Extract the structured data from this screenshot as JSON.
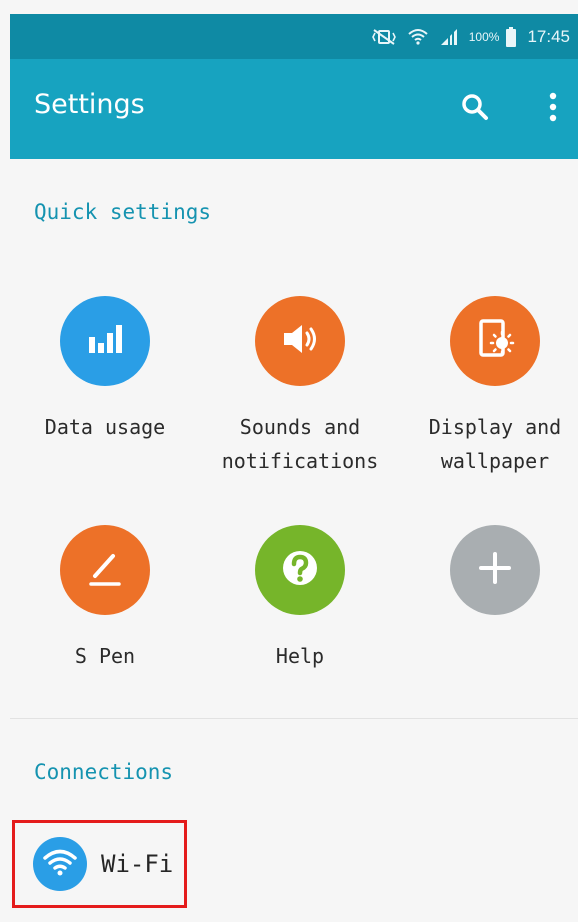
{
  "status_bar": {
    "battery_percent": "100%",
    "time": "17:45"
  },
  "app_bar": {
    "title": "Settings",
    "search_icon": "search-icon",
    "more_icon": "more-vertical-icon"
  },
  "quick_settings": {
    "title": "Quick settings",
    "tiles": [
      {
        "label_lines": [
          "Data usage"
        ],
        "icon": "bar-chart-icon",
        "color": "#2a9ee6"
      },
      {
        "label_lines": [
          "Sounds and",
          "notifications"
        ],
        "icon": "speaker-icon",
        "color": "#ed7128"
      },
      {
        "label_lines": [
          "Display and",
          "wallpaper"
        ],
        "icon": "display-brightness-icon",
        "color": "#ed7128"
      },
      {
        "label_lines": [
          "S Pen"
        ],
        "icon": "pen-icon",
        "color": "#ed7128"
      },
      {
        "label_lines": [
          "Help"
        ],
        "icon": "help-icon",
        "color": "#76b52a"
      },
      {
        "label_lines": [],
        "icon": "add-icon",
        "color": "#a9aeb1"
      }
    ]
  },
  "connections": {
    "title": "Connections",
    "items": [
      {
        "label": "Wi-Fi",
        "icon": "wifi-icon",
        "color": "#2a9ee6",
        "highlight_color": "#e41b1b"
      }
    ]
  }
}
